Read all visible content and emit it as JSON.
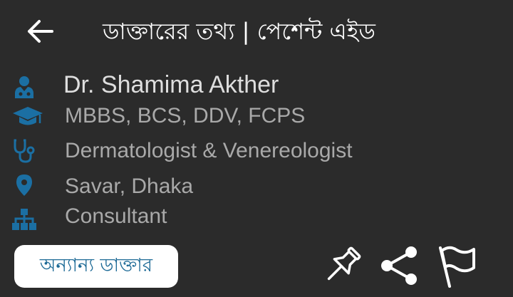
{
  "appbar": {
    "title": "ডাক্তারের তথ্য | পেশেন্ট এইড",
    "back_icon": "arrow-left-icon"
  },
  "doctor": {
    "name": "Dr. Shamima Akther",
    "degrees": "MBBS, BCS, DDV, FCPS",
    "specialty": "Dermatologist & Venereologist",
    "location": "Savar, Dhaka",
    "position": "Consultant"
  },
  "icons": {
    "name": "user-doctor-icon",
    "degrees": "graduation-cap-icon",
    "specialty": "stethoscope-icon",
    "location": "map-marker-icon",
    "position": "sitemap-icon",
    "pin": "pin-icon",
    "share": "share-icon",
    "report": "flag-icon"
  },
  "actions": {
    "other_doctors_label": "অন্যান্য ডাক্তার"
  },
  "colors": {
    "background": "#2b2b2b",
    "icon_blue": "#1b6fa3",
    "name_text": "#dedede",
    "detail_text": "#a9a9a9",
    "button_bg": "#ffffff",
    "button_text": "#1d6a96",
    "action_icon": "#ffffff"
  }
}
